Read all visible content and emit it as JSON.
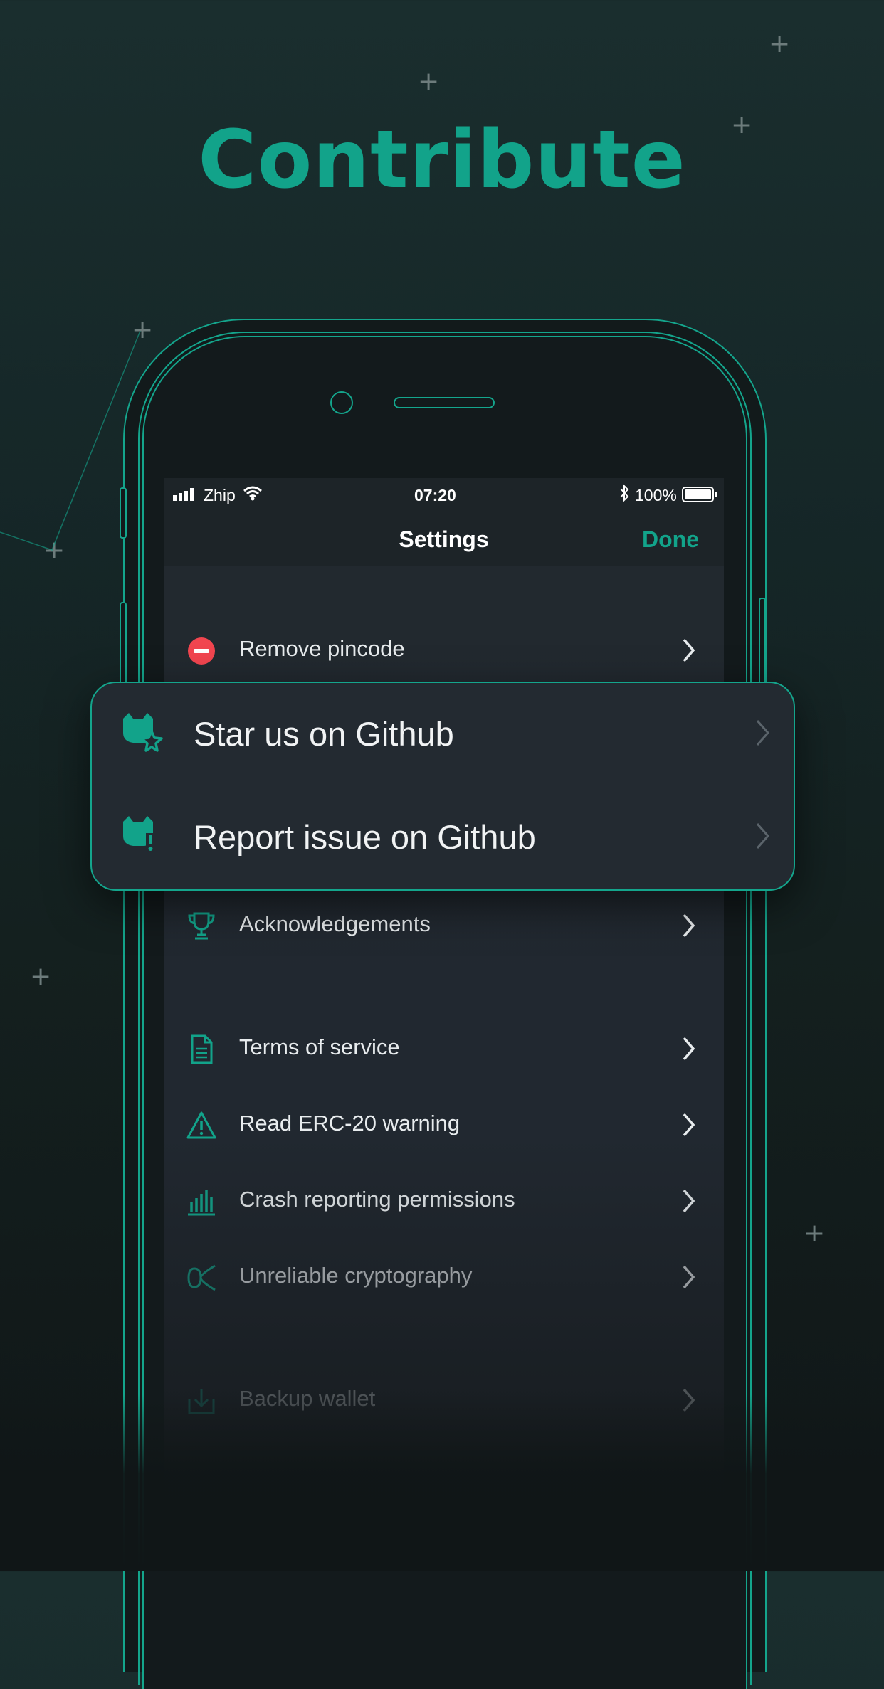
{
  "headline": "Contribute",
  "status_bar": {
    "carrier": "Zhip",
    "time": "07:20",
    "battery": "100%"
  },
  "nav": {
    "title": "Settings",
    "done_label": "Done"
  },
  "settings_items": [
    {
      "label": "Remove pincode",
      "icon": "remove-icon"
    },
    {
      "label": "Acknowledgements",
      "icon": "trophy-icon"
    },
    {
      "label": "Terms of service",
      "icon": "document-icon"
    },
    {
      "label": "Read ERC-20 warning",
      "icon": "warning-icon"
    },
    {
      "label": "Crash reporting permissions",
      "icon": "bar-chart-icon"
    },
    {
      "label": "Unreliable cryptography",
      "icon": "curve-icon"
    },
    {
      "label": "Backup wallet",
      "icon": "backup-icon"
    }
  ],
  "card_items": [
    {
      "label": "Star us on Github",
      "icon": "github-star-icon"
    },
    {
      "label": "Report issue on Github",
      "icon": "github-issue-icon"
    }
  ],
  "colors": {
    "accent": "#12a38a",
    "danger": "#f1454f",
    "background": "#152627",
    "card": "#232a31"
  }
}
